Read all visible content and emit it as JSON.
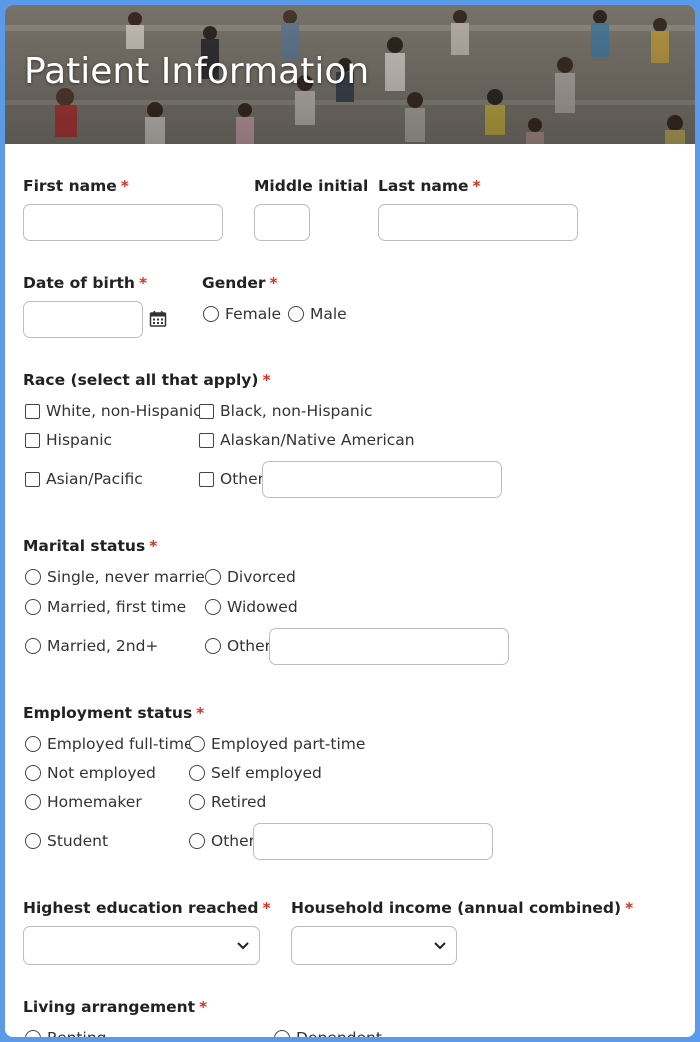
{
  "header": {
    "title": "Patient Information"
  },
  "name_row": {
    "first": {
      "label": "First name",
      "required_mark": "*",
      "value": ""
    },
    "middle": {
      "label": "Middle initial",
      "value": ""
    },
    "last": {
      "label": "Last name",
      "required_mark": "*",
      "value": ""
    }
  },
  "dob": {
    "label": "Date of birth",
    "required_mark": "*",
    "value": "",
    "icon": "calendar-icon"
  },
  "gender": {
    "label": "Gender",
    "required_mark": "*",
    "options": [
      "Female",
      "Male"
    ]
  },
  "race": {
    "label": "Race (select all that apply)",
    "required_mark": "*",
    "options": [
      "White, non-Hispanic",
      "Black, non-Hispanic",
      "Hispanic",
      "Alaskan/Native American",
      "Asian/Pacific",
      "Other"
    ],
    "other_value": ""
  },
  "marital": {
    "label": "Marital status",
    "required_mark": "*",
    "options": [
      "Single, never married",
      "Divorced",
      "Married, first time",
      "Widowed",
      "Married, 2nd+",
      "Other"
    ],
    "other_value": ""
  },
  "employment": {
    "label": "Employment status",
    "required_mark": "*",
    "options": [
      "Employed full-time",
      "Employed part-time",
      "Not employed",
      "Self employed",
      "Homemaker",
      "Retired",
      "Student",
      "Other"
    ],
    "other_value": ""
  },
  "education": {
    "label": "Highest education reached",
    "required_mark": "*",
    "selected": ""
  },
  "income": {
    "label": "Household income (annual combined)",
    "required_mark": "*",
    "selected": ""
  },
  "living": {
    "label": "Living arrangement",
    "required_mark": "*",
    "options": [
      "Renting",
      "Dependent"
    ]
  },
  "colors": {
    "frame": "#5b9ae8",
    "required": "#d93025",
    "border": "#bdbdbd"
  }
}
